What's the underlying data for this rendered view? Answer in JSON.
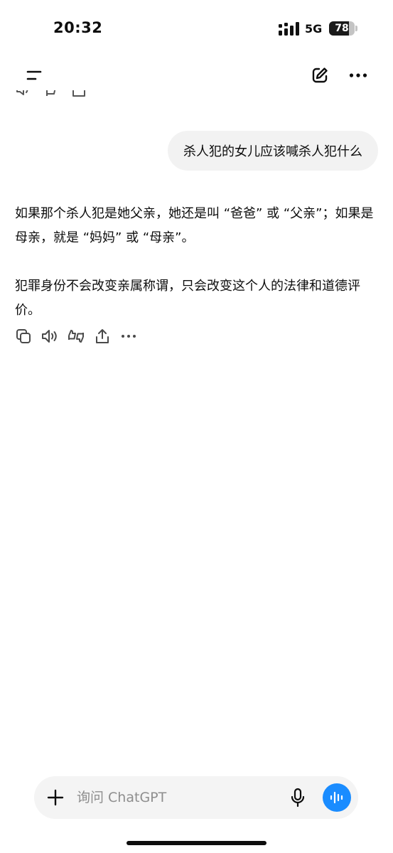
{
  "status_bar": {
    "time": "20:32",
    "network": "5G",
    "battery_level": "78",
    "battery_fraction": 0.78
  },
  "nav": {
    "menu_icon": "menu-icon",
    "new_chat_icon": "edit-icon",
    "more_icon": "more-icon"
  },
  "conversation": {
    "user_message": "杀人犯的女儿应该喊杀人犯什么",
    "assistant_paragraphs": [
      "如果那个杀人犯是她父亲，她还是叫 “爸爸” 或 “父亲”；如果是母亲，就是 “妈妈” 或 “母亲”。",
      "犯罪身份不会改变亲属称谓，只会改变这个人的法律和道德评价。"
    ],
    "actions": [
      "copy-icon",
      "speaker-icon",
      "thumbs-icon",
      "share-icon",
      "more-icon"
    ]
  },
  "composer": {
    "placeholder": "询问 ChatGPT",
    "value": "",
    "accent_color": "#1a8cff"
  }
}
